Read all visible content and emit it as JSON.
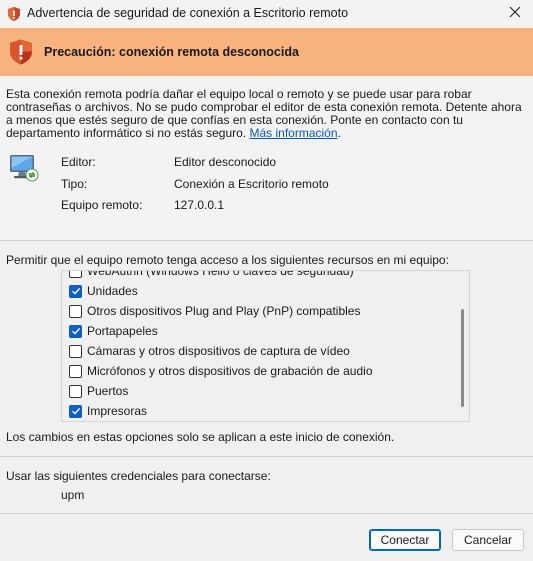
{
  "window": {
    "title": "Advertencia de seguridad de conexión a Escritorio remoto",
    "icons": {
      "app": "rdp-shield-icon",
      "close": "close-icon"
    }
  },
  "banner": {
    "text": "Precaución: conexión remota desconocida",
    "icon": "warning-shield-icon",
    "color": "#f8b37f"
  },
  "description": {
    "text": "Esta conexión remota podría dañar el equipo local o remoto y se puede usar para robar contraseñas o archivos. No se pudo comprobar el editor de esta conexión remota. Detente ahora a menos que estés seguro de que confías en esta conexión. Ponte en contacto con tu departamento informático si no estás seguro.",
    "link": "Más información",
    "link_suffix": "."
  },
  "info": {
    "icon": "remote-desktop-icon",
    "rows": [
      {
        "label": "Editor:",
        "value": "Editor desconocido"
      },
      {
        "label": "Tipo:",
        "value": "Conexión a Escritorio remoto"
      },
      {
        "label": "Equipo remoto:",
        "value": "127.0.0.1"
      }
    ]
  },
  "permissions": {
    "label": "Permitir que el equipo remoto tenga acceso a los siguientes recursos en mi equipo:",
    "items": [
      {
        "label": "WebAuthn (Windows Hello o claves de seguridad)",
        "checked": false
      },
      {
        "label": "Unidades",
        "checked": true
      },
      {
        "label": "Otros dispositivos Plug and Play (PnP) compatibles",
        "checked": false
      },
      {
        "label": "Portapapeles",
        "checked": true
      },
      {
        "label": "Cámaras y otros dispositivos de captura de vídeo",
        "checked": false
      },
      {
        "label": "Micrófonos y otros dispositivos de grabación de audio",
        "checked": false
      },
      {
        "label": "Puertos",
        "checked": false
      },
      {
        "label": "Impresoras",
        "checked": true
      }
    ],
    "note": "Los cambios en estas opciones solo se aplican a este inicio de conexión."
  },
  "credentials": {
    "label": "Usar las siguientes credenciales para conectarse:",
    "user": "upm"
  },
  "buttons": {
    "connect": "Conectar",
    "cancel": "Cancelar"
  },
  "colors": {
    "accent": "#0a5fc7",
    "link": "#0a56b8"
  }
}
